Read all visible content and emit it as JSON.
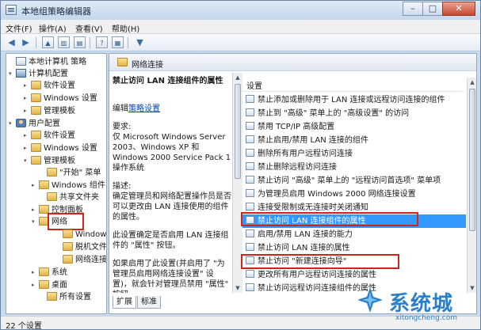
{
  "window": {
    "title": "本地组策略编辑器"
  },
  "menu": [
    "文件(F)",
    "操作(A)",
    "查看(V)",
    "帮助(H)"
  ],
  "tree": [
    {
      "label": "本地计算机 策略",
      "icon": "policy-icon",
      "exp": ""
    },
    {
      "label": "计算机配置",
      "icon": "computer-icon",
      "exp": "▾"
    },
    {
      "label": "软件设置",
      "icon": "folder-icon",
      "exp": "▸"
    },
    {
      "label": "Windows 设置",
      "icon": "folder-icon",
      "exp": "▸"
    },
    {
      "label": "管理模板",
      "icon": "folder-icon",
      "exp": "▸"
    },
    {
      "label": "用户配置",
      "icon": "user-icon",
      "exp": "▾"
    },
    {
      "label": "软件设置",
      "icon": "folder-icon",
      "exp": "▸"
    },
    {
      "label": "Windows 设置",
      "icon": "folder-icon",
      "exp": "▸"
    },
    {
      "label": "管理模板",
      "icon": "folder-icon",
      "exp": "▾"
    },
    {
      "label": "\"开始\" 菜单",
      "icon": "folder-icon",
      "exp": ""
    },
    {
      "label": "Windows 组件",
      "icon": "folder-icon",
      "exp": "▸"
    },
    {
      "label": "共享文件夹",
      "icon": "folder-icon",
      "exp": ""
    },
    {
      "label": "控制面板",
      "icon": "folder-icon",
      "exp": "▸"
    },
    {
      "label": "网络",
      "icon": "folder-icon",
      "exp": "▾"
    },
    {
      "label": "Windows",
      "icon": "folder-icon",
      "exp": ""
    },
    {
      "label": "脱机文件",
      "icon": "folder-icon",
      "exp": ""
    },
    {
      "label": "网络连接",
      "icon": "folder-icon",
      "exp": ""
    },
    {
      "label": "系统",
      "icon": "folder-icon",
      "exp": "▸"
    },
    {
      "label": "桌面",
      "icon": "folder-icon",
      "exp": "▸"
    },
    {
      "label": "所有设置",
      "icon": "folder-icon",
      "exp": ""
    }
  ],
  "right": {
    "header": "网络连接",
    "desc_title": "禁止访问 LAN 连接组件的属性",
    "edit_prefix": "编辑",
    "edit_link": "策略设置",
    "req_label": "要求:",
    "req_text": "仅 Microsoft Windows Server 2003、Windows XP 和 Windows 2000 Service Pack 1 操作系统",
    "desc_label": "描述:",
    "desc_text": "确定管理员和网络配置操作员是否可以更改由 LAN 连接使用的组件的属性。",
    "desc_text2": "此设置确定是否启用 LAN 连接组件的 \"属性\" 按钮。",
    "desc_text3": "如果启用了此设置(并启用了 \"为管理员启用网络连接设置\" 设置)，就会针对管理员禁用 \"属性\" 按钮。",
    "column_header": "设置",
    "settings": [
      "禁止添加或删除用于 LAN 连接或远程访问连接的组件",
      "禁止到 \"高级\" 菜单上的 \"高级设置\" 的访问",
      "禁用 TCP/IP 高级配置",
      "禁止启用/禁用 LAN 连接的组件",
      "删除所有用户远程访问连接",
      "禁止删除远程访问连接",
      "禁止访问 \"高级\" 菜单上的 \"远程访问首选项\" 菜单项",
      "为管理员启用 Windows 2000 网络连接设置",
      "连接受限制或无连接时关闭通知",
      "禁止访问 LAN 连接组件的属性",
      "启用/禁用 LAN 连接的能力",
      "禁止访问 LAN 连接的属性",
      "禁止访问 \"新建连接向导\"",
      "更改所有用户远程访问连接的属性",
      "禁止访问远程访问连接组件的属性"
    ],
    "selected_index": 9,
    "tabs": [
      "扩展",
      "标准"
    ]
  },
  "status": "22 个设置",
  "watermark": {
    "text": "系统城",
    "url": "xitongcheng.com"
  },
  "colors": {
    "selection": "#3399ff",
    "highlight_border": "#d0241a",
    "link": "#0645ad"
  }
}
